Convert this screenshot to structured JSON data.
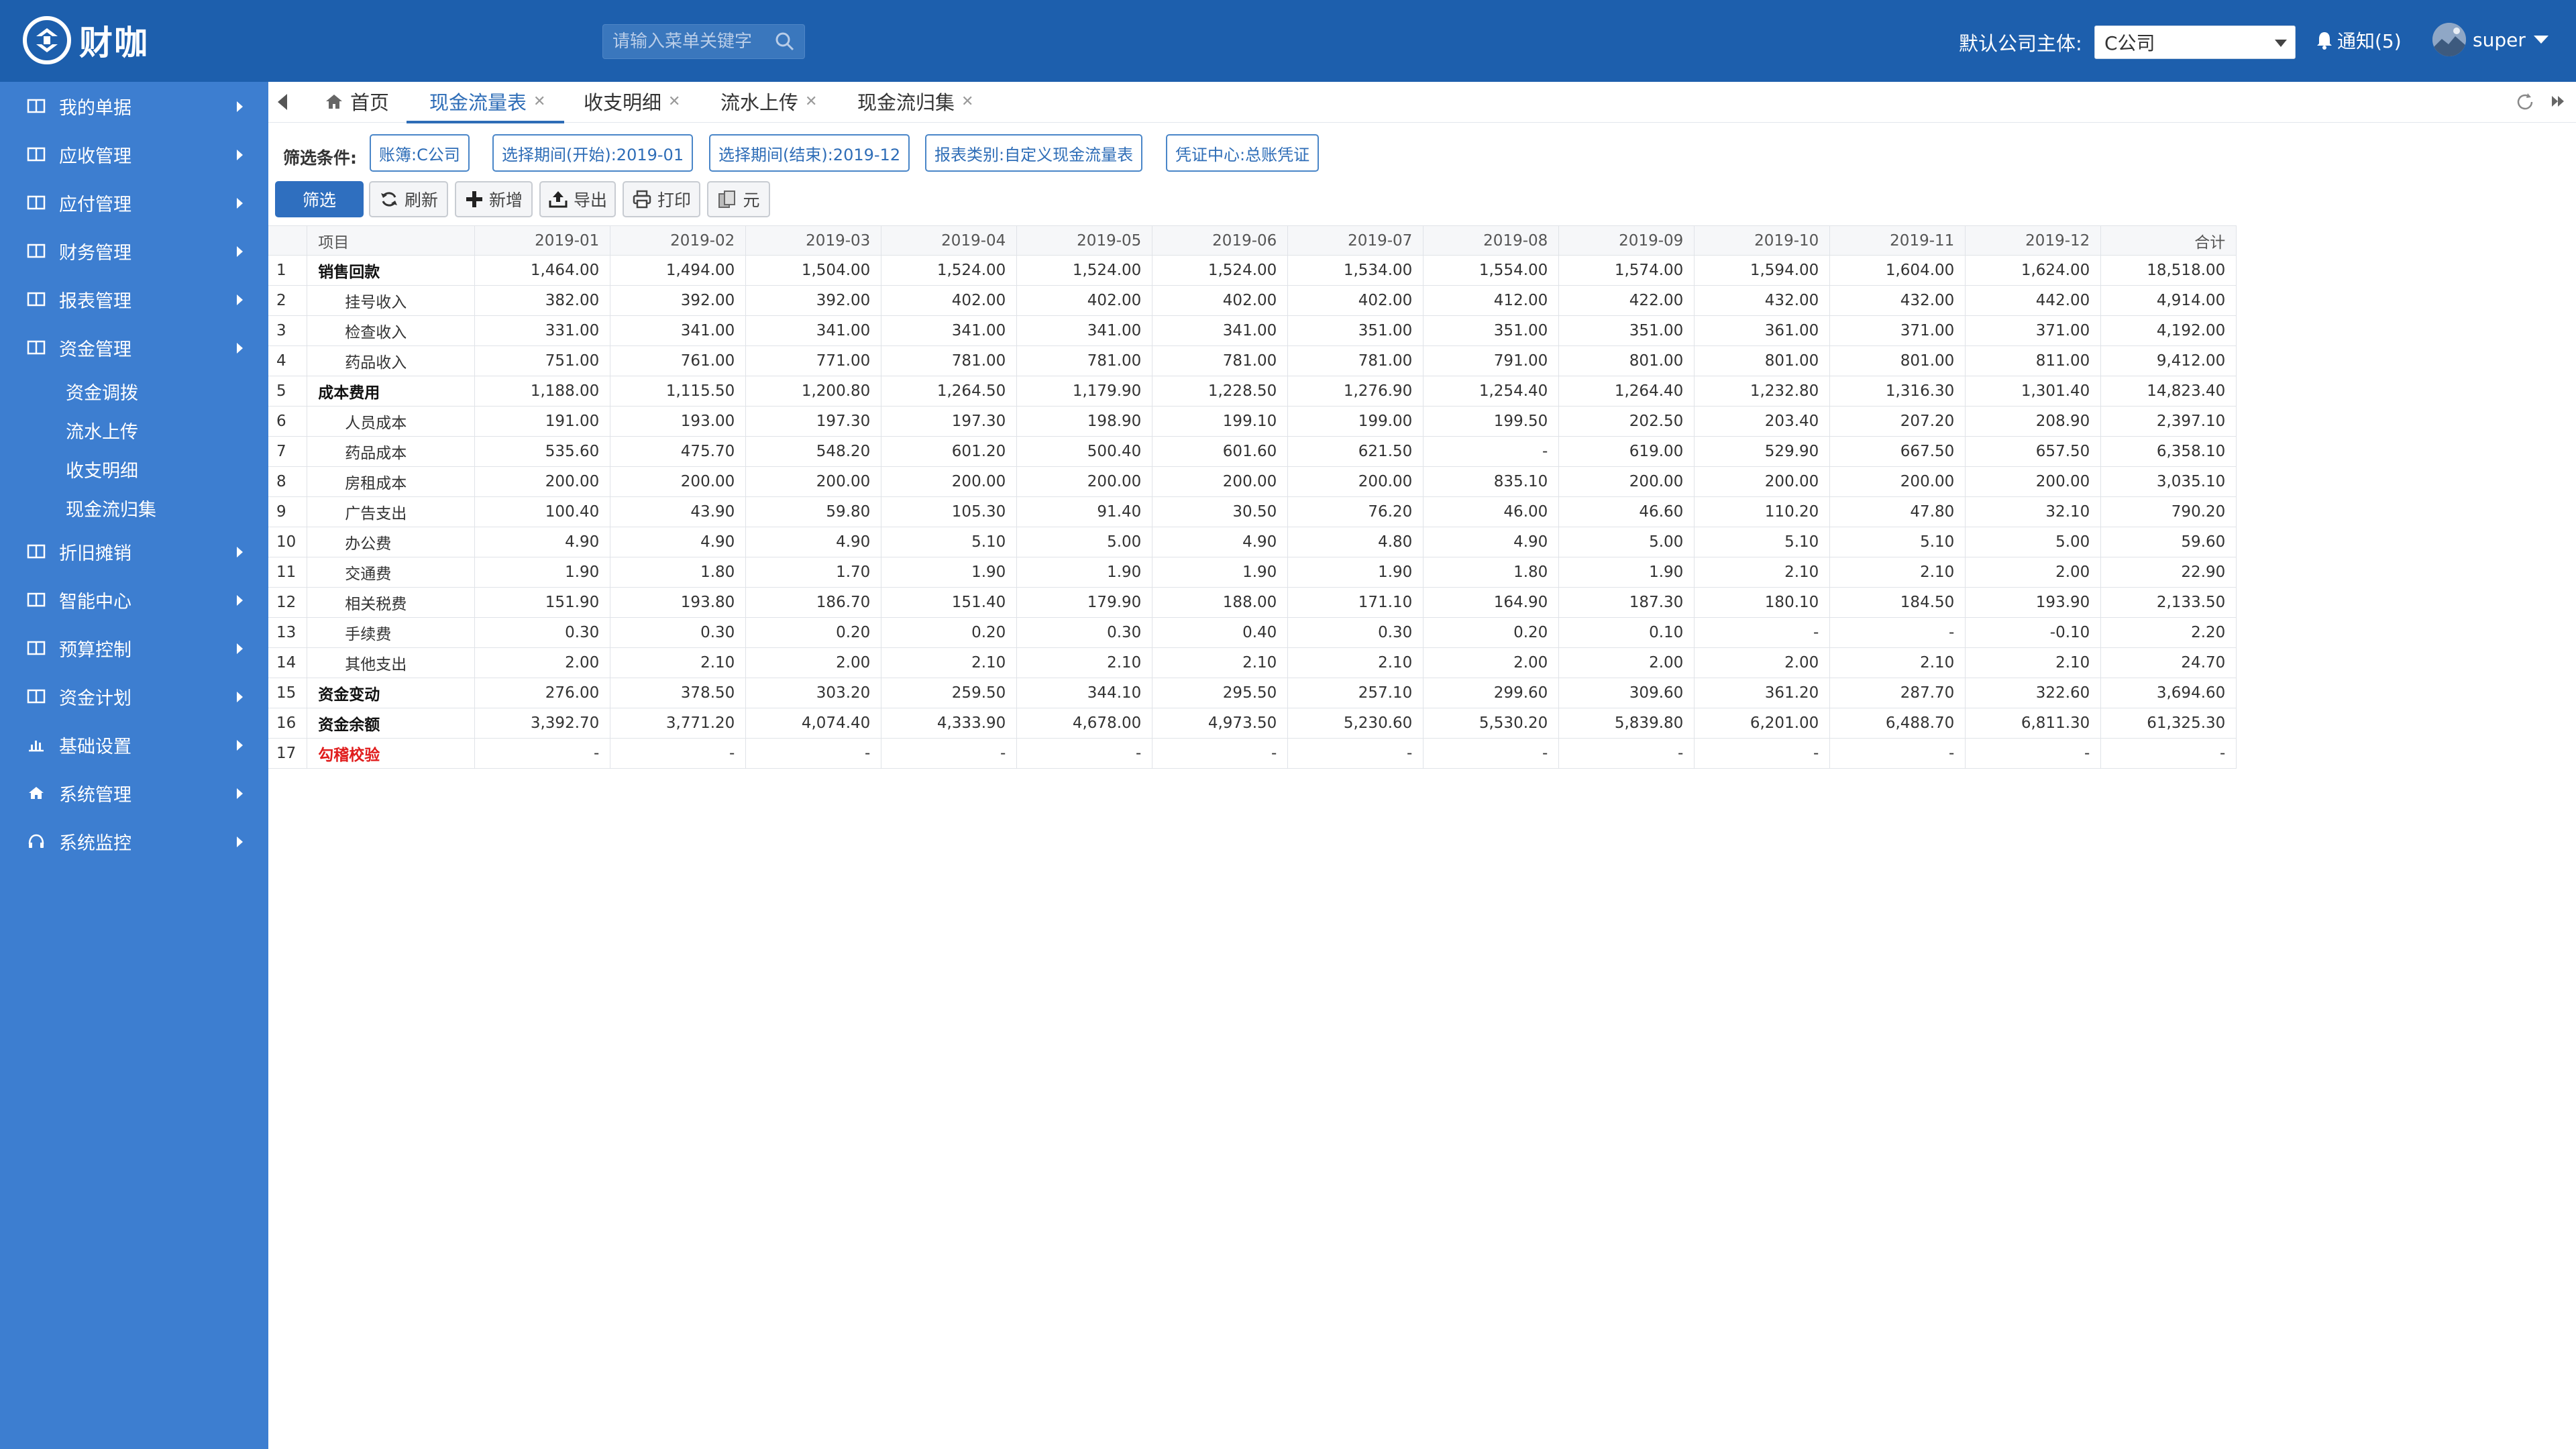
{
  "brand": {
    "name": "财咖",
    "colors": {
      "header": "#1d5fad",
      "sidebar": "#3d7ed0",
      "accent": "#2e6db7"
    }
  },
  "header": {
    "search_placeholder": "请输入菜单关键字",
    "company_label": "默认公司主体:",
    "company_value": "C公司",
    "notice": "通知(5)",
    "user": "super"
  },
  "sidebar": {
    "items": [
      {
        "label": "我的单据",
        "icon": "table-icon"
      },
      {
        "label": "应收管理",
        "icon": "table-icon"
      },
      {
        "label": "应付管理",
        "icon": "table-icon"
      },
      {
        "label": "财务管理",
        "icon": "table-icon"
      },
      {
        "label": "报表管理",
        "icon": "table-icon"
      },
      {
        "label": "资金管理",
        "icon": "table-icon"
      }
    ],
    "sub_items": [
      "资金调拨",
      "流水上传",
      "收支明细",
      "现金流归集"
    ],
    "items_after": [
      {
        "label": "折旧摊销",
        "icon": "table-icon"
      },
      {
        "label": "智能中心",
        "icon": "table-icon"
      },
      {
        "label": "预算控制",
        "icon": "table-icon"
      },
      {
        "label": "资金计划",
        "icon": "table-icon"
      },
      {
        "label": "基础设置",
        "icon": "bar-chart-icon"
      },
      {
        "label": "系统管理",
        "icon": "home-icon"
      },
      {
        "label": "系统监控",
        "icon": "headset-icon"
      }
    ]
  },
  "tabs": [
    {
      "label": "首页",
      "closable": false
    },
    {
      "label": "现金流量表",
      "closable": true,
      "active": true
    },
    {
      "label": "收支明细",
      "closable": true
    },
    {
      "label": "流水上传",
      "closable": true
    },
    {
      "label": "现金流归集",
      "closable": true
    }
  ],
  "filters": {
    "label": "筛选条件:",
    "chips": [
      "账簿:C公司",
      "选择期间(开始):2019-01",
      "选择期间(结束):2019-12",
      "报表类别:自定义现金流量表",
      "凭证中心:总账凭证"
    ]
  },
  "toolbar": {
    "filter": "筛选",
    "refresh": "刷新",
    "add": "新增",
    "export": "导出",
    "print": "打印",
    "unit": "元"
  },
  "table": {
    "headers": [
      "项目",
      "2019-01",
      "2019-02",
      "2019-03",
      "2019-04",
      "2019-05",
      "2019-06",
      "2019-07",
      "2019-08",
      "2019-09",
      "2019-10",
      "2019-11",
      "2019-12",
      "合计"
    ],
    "rows": [
      {
        "idx": "1",
        "name": "销售回款",
        "level": 1,
        "values": [
          "1,464.00",
          "1,494.00",
          "1,504.00",
          "1,524.00",
          "1,524.00",
          "1,524.00",
          "1,534.00",
          "1,554.00",
          "1,574.00",
          "1,594.00",
          "1,604.00",
          "1,624.00",
          "18,518.00"
        ]
      },
      {
        "idx": "2",
        "name": "挂号收入",
        "level": 2,
        "values": [
          "382.00",
          "392.00",
          "392.00",
          "402.00",
          "402.00",
          "402.00",
          "402.00",
          "412.00",
          "422.00",
          "432.00",
          "432.00",
          "442.00",
          "4,914.00"
        ]
      },
      {
        "idx": "3",
        "name": "检查收入",
        "level": 2,
        "values": [
          "331.00",
          "341.00",
          "341.00",
          "341.00",
          "341.00",
          "341.00",
          "351.00",
          "351.00",
          "351.00",
          "361.00",
          "371.00",
          "371.00",
          "4,192.00"
        ]
      },
      {
        "idx": "4",
        "name": "药品收入",
        "level": 2,
        "values": [
          "751.00",
          "761.00",
          "771.00",
          "781.00",
          "781.00",
          "781.00",
          "781.00",
          "791.00",
          "801.00",
          "801.00",
          "801.00",
          "811.00",
          "9,412.00"
        ]
      },
      {
        "idx": "5",
        "name": "成本费用",
        "level": 1,
        "values": [
          "1,188.00",
          "1,115.50",
          "1,200.80",
          "1,264.50",
          "1,179.90",
          "1,228.50",
          "1,276.90",
          "1,254.40",
          "1,264.40",
          "1,232.80",
          "1,316.30",
          "1,301.40",
          "14,823.40"
        ]
      },
      {
        "idx": "6",
        "name": "人员成本",
        "level": 2,
        "values": [
          "191.00",
          "193.00",
          "197.30",
          "197.30",
          "198.90",
          "199.10",
          "199.00",
          "199.50",
          "202.50",
          "203.40",
          "207.20",
          "208.90",
          "2,397.10"
        ]
      },
      {
        "idx": "7",
        "name": "药品成本",
        "level": 2,
        "values": [
          "535.60",
          "475.70",
          "548.20",
          "601.20",
          "500.40",
          "601.60",
          "621.50",
          "-",
          "619.00",
          "529.90",
          "667.50",
          "657.50",
          "6,358.10"
        ]
      },
      {
        "idx": "8",
        "name": "房租成本",
        "level": 2,
        "values": [
          "200.00",
          "200.00",
          "200.00",
          "200.00",
          "200.00",
          "200.00",
          "200.00",
          "835.10",
          "200.00",
          "200.00",
          "200.00",
          "200.00",
          "3,035.10"
        ]
      },
      {
        "idx": "9",
        "name": "广告支出",
        "level": 2,
        "values": [
          "100.40",
          "43.90",
          "59.80",
          "105.30",
          "91.40",
          "30.50",
          "76.20",
          "46.00",
          "46.60",
          "110.20",
          "47.80",
          "32.10",
          "790.20"
        ]
      },
      {
        "idx": "10",
        "name": "办公费",
        "level": 2,
        "values": [
          "4.90",
          "4.90",
          "4.90",
          "5.10",
          "5.00",
          "4.90",
          "4.80",
          "4.90",
          "5.00",
          "5.10",
          "5.10",
          "5.00",
          "59.60"
        ]
      },
      {
        "idx": "11",
        "name": "交通费",
        "level": 2,
        "values": [
          "1.90",
          "1.80",
          "1.70",
          "1.90",
          "1.90",
          "1.90",
          "1.90",
          "1.80",
          "1.90",
          "2.10",
          "2.10",
          "2.00",
          "22.90"
        ]
      },
      {
        "idx": "12",
        "name": "相关税费",
        "level": 2,
        "values": [
          "151.90",
          "193.80",
          "186.70",
          "151.40",
          "179.90",
          "188.00",
          "171.10",
          "164.90",
          "187.30",
          "180.10",
          "184.50",
          "193.90",
          "2,133.50"
        ]
      },
      {
        "idx": "13",
        "name": "手续费",
        "level": 2,
        "values": [
          "0.30",
          "0.30",
          "0.20",
          "0.20",
          "0.30",
          "0.40",
          "0.30",
          "0.20",
          "0.10",
          "-",
          "-",
          "-0.10",
          "2.20"
        ]
      },
      {
        "idx": "14",
        "name": "其他支出",
        "level": 2,
        "values": [
          "2.00",
          "2.10",
          "2.00",
          "2.10",
          "2.10",
          "2.10",
          "2.10",
          "2.00",
          "2.00",
          "2.00",
          "2.10",
          "2.10",
          "24.70"
        ]
      },
      {
        "idx": "15",
        "name": "资金变动",
        "level": 1,
        "values": [
          "276.00",
          "378.50",
          "303.20",
          "259.50",
          "344.10",
          "295.50",
          "257.10",
          "299.60",
          "309.60",
          "361.20",
          "287.70",
          "322.60",
          "3,694.60"
        ]
      },
      {
        "idx": "16",
        "name": "资金余额",
        "level": 1,
        "values": [
          "3,392.70",
          "3,771.20",
          "4,074.40",
          "4,333.90",
          "4,678.00",
          "4,973.50",
          "5,230.60",
          "5,530.20",
          "5,839.80",
          "6,201.00",
          "6,488.70",
          "6,811.30",
          "61,325.30"
        ]
      },
      {
        "idx": "17",
        "name": "勾稽校验",
        "level": "check",
        "values": [
          "-",
          "-",
          "-",
          "-",
          "-",
          "-",
          "-",
          "-",
          "-",
          "-",
          "-",
          "-",
          "-"
        ]
      }
    ]
  }
}
